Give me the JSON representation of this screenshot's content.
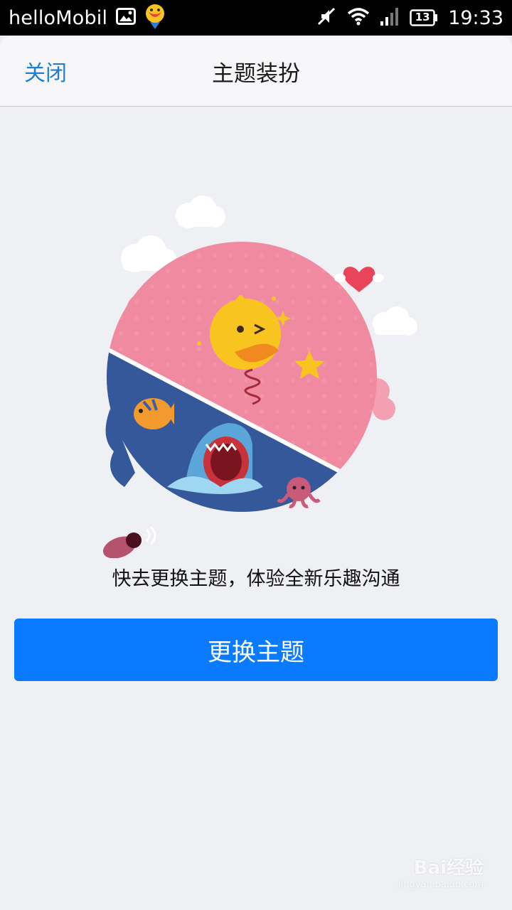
{
  "status_bar": {
    "app_name": "helloMobil",
    "battery": "13",
    "time": "19:33",
    "icons": [
      "gallery-icon",
      "qq-notification-icon",
      "mute-icon",
      "wifi-icon",
      "signal-icon",
      "battery-icon"
    ]
  },
  "navbar": {
    "close_label": "关闭",
    "title": "主题装扮"
  },
  "main": {
    "tagline": "快去更换主题，体验全新乐趣沟通",
    "change_button_label": "更换主题"
  },
  "watermark": {
    "brand": "Bai经验",
    "url": "jingyan.baidu.com"
  },
  "colors": {
    "accent_blue": "#0a7bff",
    "link_blue": "#1e7fd2",
    "pink": "#ef8aa0",
    "ocean": "#35589a"
  }
}
